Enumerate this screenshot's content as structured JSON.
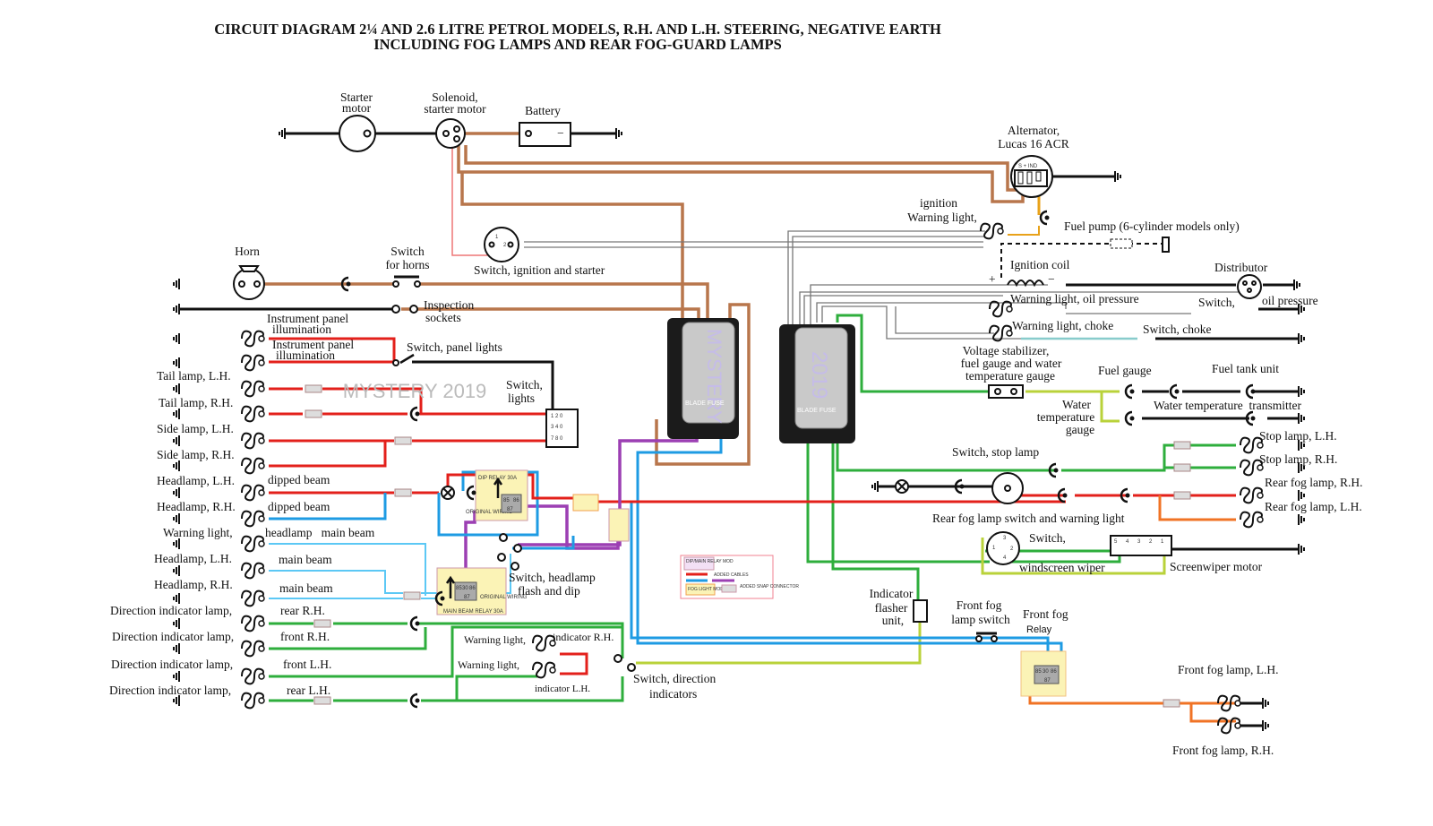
{
  "title": {
    "line1": "CIRCUIT DIAGRAM 2¼ AND 2.6 LITRE PETROL MODELS, R.H. AND L.H. STEERING, NEGATIVE EARTH",
    "line2": "INCLUDING FOG LAMPS AND REAR FOG-GUARD LAMPS"
  },
  "watermark": "MYSTERY 2019",
  "labels": {
    "starter_motor": [
      "Starter",
      "motor"
    ],
    "solenoid": [
      "Solenoid,",
      "starter motor"
    ],
    "battery": "Battery",
    "alternator": [
      "Alternator,",
      "Lucas 16 ACR"
    ],
    "alternator_pins": "S + IND",
    "ignition_warning": [
      "ignition",
      "Warning light,"
    ],
    "fuel_pump": "Fuel pump (6-cylinder models only)",
    "ignition_coil": "Ignition coil",
    "distributor": "Distributor",
    "warning_oil": "Warning light, oil pressure",
    "switch_oil": [
      "Switch,",
      "oil pressure"
    ],
    "warning_choke": "Warning light, choke",
    "switch_choke": "Switch, choke",
    "voltage_stabilizer": [
      "Voltage stabilizer,",
      "fuel gauge and water",
      "temperature gauge"
    ],
    "fuel_gauge": "Fuel gauge",
    "fuel_tank_unit": "Fuel tank unit",
    "water_temp_gauge": [
      "Water",
      "temperature",
      "gauge"
    ],
    "water_temp_transmitter": "Water temperature  transmitter",
    "stop_lamp_lh": "Stop lamp, L.H.",
    "stop_lamp_rh": "Stop lamp, R.H.",
    "switch_stop_lamp": "Switch, stop lamp",
    "rear_fog_rh": "Rear fog lamp, R.H.",
    "rear_fog_lh": "Rear fog lamp, L.H.",
    "rear_fog_switch": "Rear fog lamp switch and warning light",
    "wiper_switch": [
      "Switch,",
      "windscreen wiper"
    ],
    "wiper_switch_pins": [
      "3",
      "1",
      "2",
      "4"
    ],
    "screenwiper_motor": "Screenwiper motor",
    "wiper_motor_pins": [
      "5",
      "4",
      "3",
      "2",
      "1"
    ],
    "indicator_flasher": [
      "Indicator",
      "flasher",
      "unit,"
    ],
    "front_fog_switch": [
      "Front fog",
      "lamp switch"
    ],
    "front_fog_relay": [
      "Front fog",
      "Relay"
    ],
    "front_fog_lh": "Front fog lamp, L.H.",
    "front_fog_rh": "Front fog lamp, R.H.",
    "horn": "Horn",
    "switch_horns": [
      "Switch",
      "for horns"
    ],
    "switch_ignition": "Switch, ignition and starter",
    "ignition_pins": [
      "1",
      "2"
    ],
    "inspection_sockets": [
      "Inspection",
      "sockets"
    ],
    "instrument_illum_1": [
      "Instrument panel",
      "illumination"
    ],
    "instrument_illum_2": [
      "Instrument panel",
      "illumination"
    ],
    "switch_panel_lights": "Switch, panel lights",
    "switch_lights": [
      "Switch,",
      "lights"
    ],
    "tail_lh": "Tail lamp, L.H.",
    "tail_rh": "Tail lamp, R.H.",
    "side_lh": "Side lamp, L.H.",
    "side_rh": "Side lamp, R.H.",
    "headlamp_lh_dip": [
      "Headlamp, L.H.",
      "dipped beam"
    ],
    "headlamp_rh_dip": [
      "Headlamp, R.H.",
      "dipped beam"
    ],
    "warning_main_beam": [
      "Warning light,",
      "headlamp   main beam"
    ],
    "headlamp_lh_main": [
      "Headlamp, L.H.",
      "main beam"
    ],
    "headlamp_rh_main": [
      "Headlamp, R.H.",
      "main beam"
    ],
    "ind_rear_rh": [
      "Direction indicator lamp,",
      "rear R.H."
    ],
    "ind_front_rh": [
      "Direction indicator lamp,",
      "front R.H."
    ],
    "ind_front_lh": [
      "Direction indicator lamp,",
      "front L.H."
    ],
    "ind_rear_lh": [
      "Direction indicator lamp,",
      "rear L.H."
    ],
    "switch_flash_dip": [
      "Switch, headlamp",
      "flash and dip"
    ],
    "warning_ind_rh": [
      "Warning light,",
      "indicator R.H."
    ],
    "warning_ind_lh": [
      "Warning light,",
      "indicator L.H."
    ],
    "switch_direction": [
      "Switch, direction",
      "indicators"
    ]
  },
  "fuse_boxes": [
    {
      "cover_text": "MYSTERY",
      "label": "BLADE FUSE"
    },
    {
      "cover_text": "2019",
      "label": "BLADE FUSE"
    }
  ],
  "relays": {
    "dip": {
      "label": "DIP RELAY 30A",
      "note": "ORIGINAL WIRING",
      "pins": [
        "85",
        "30",
        "86",
        "87"
      ]
    },
    "main": {
      "label": "MAIN BEAM RELAY 30A",
      "note": "ORIGINAL WIRING",
      "pins": [
        "85",
        "30",
        "86",
        "87"
      ]
    },
    "fog": {
      "pins": [
        "85",
        "30",
        "86",
        "87"
      ]
    }
  },
  "legend": {
    "dip_main": "DIP/MAIN RELAY MOD",
    "added_cables": "ADDED CABLES",
    "fog_light": "FOG LIGHT MOD",
    "snap": "ADDED SNAP CONNECTOR"
  },
  "colors": {
    "brown": "#b8764c",
    "red": "#e3201b",
    "blue": "#1e9be3",
    "purple": "#9c3fb3",
    "green": "#2eae3c",
    "yellow_green": "#b9d23a",
    "orange": "#f07325",
    "relay_bg": "#fbf3b6"
  }
}
